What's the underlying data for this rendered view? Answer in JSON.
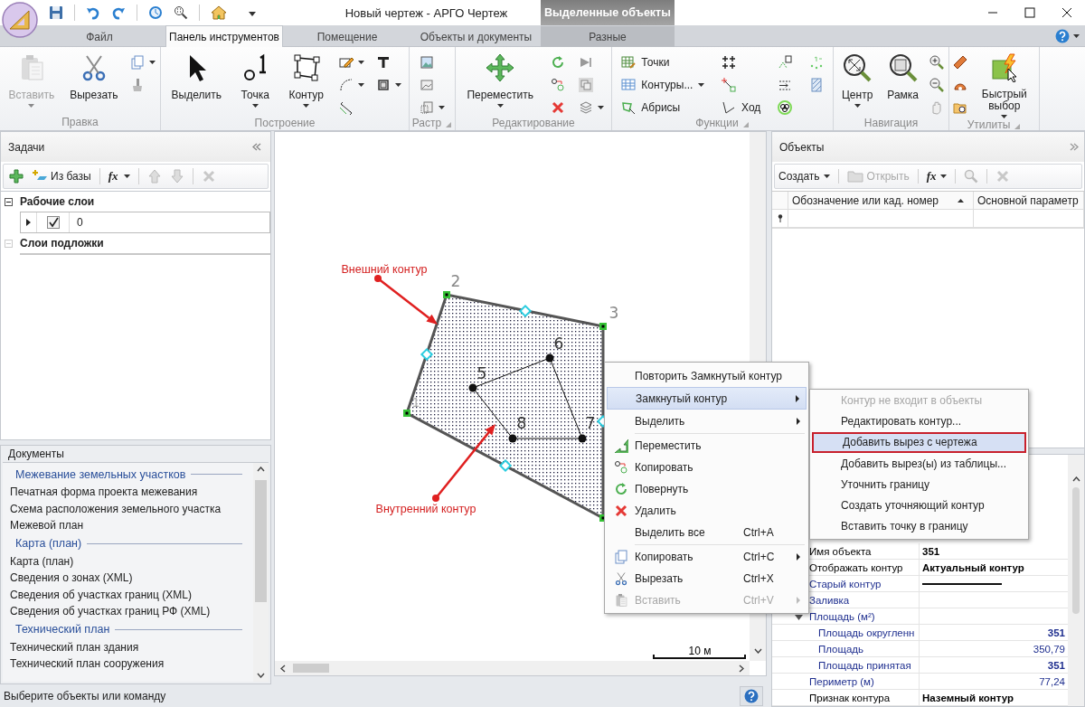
{
  "window": {
    "title": "Новый чертеж - АРГО Чертеж",
    "context_tab": "Выделенные объекты"
  },
  "tabs": [
    {
      "label": "Файл",
      "selected": false,
      "contextual": false
    },
    {
      "label": "Панель инструментов",
      "selected": true,
      "contextual": false
    },
    {
      "label": "Помещение",
      "selected": false,
      "contextual": false
    },
    {
      "label": "Объекты и документы",
      "selected": false,
      "contextual": false
    },
    {
      "label": "Разные",
      "selected": false,
      "contextual": true
    }
  ],
  "ribbon": {
    "groups": [
      {
        "label": "Правка",
        "buttons": [
          {
            "label": "Вставить",
            "disabled": true
          },
          {
            "label": "Вырезать",
            "disabled": false
          }
        ]
      },
      {
        "label": "Построение",
        "buttons": [
          {
            "label": "Выделить",
            "disabled": false
          },
          {
            "label": "Точка",
            "disabled": false
          },
          {
            "label": "Контур",
            "disabled": false
          }
        ]
      },
      {
        "label": "Растр"
      },
      {
        "label": "Редактирование",
        "buttons": [
          {
            "label": "Переместить",
            "disabled": false
          }
        ]
      },
      {
        "label": "Функции",
        "buttons": [
          {
            "label": "Точки",
            "disabled": false
          },
          {
            "label": "Контуры...",
            "disabled": false
          },
          {
            "label": "Абрисы",
            "disabled": false
          },
          {
            "label": "Ход",
            "disabled": false
          }
        ]
      },
      {
        "label": "Навигация",
        "buttons": [
          {
            "label": "Центр",
            "disabled": false
          },
          {
            "label": "Рамка",
            "disabled": false
          }
        ]
      },
      {
        "label": "Утилиты",
        "buttons": [
          {
            "label": "Быстрый выбор",
            "disabled": false
          }
        ]
      }
    ]
  },
  "tasks": {
    "title": "Задачи",
    "toolbar": {
      "from_db": "Из базы",
      "formula": "fx"
    },
    "sections": [
      {
        "title": "Рабочие слои",
        "expanded": true,
        "children": [
          {
            "name": "0",
            "checked": true,
            "expanded": false
          }
        ]
      },
      {
        "title": "Слои подложки",
        "expanded": true
      }
    ]
  },
  "documents": {
    "title": "Документы",
    "groups": [
      {
        "title": "Межевание земельных участков",
        "items": [
          "Печатная форма проекта межевания",
          "Схема расположения земельного участка",
          "Межевой план"
        ]
      },
      {
        "title": "Карта (план)",
        "items": [
          "Карта (план)",
          "Сведения о зонах (XML)",
          "Сведения об участках границ (XML)",
          "Сведения об участках границ РФ (XML)"
        ]
      },
      {
        "title": "Технический план",
        "items": [
          "Технический план здания",
          "Технический план сооружения"
        ]
      }
    ]
  },
  "drawing": {
    "outer_points": [
      {
        "label": "1"
      },
      {
        "label": "2"
      },
      {
        "label": "3"
      }
    ],
    "inner_points": [
      {
        "label": "5"
      },
      {
        "label": "6"
      },
      {
        "label": "7"
      },
      {
        "label": "8"
      }
    ],
    "annotations": [
      {
        "text": "Внешний контур"
      },
      {
        "text": "Внутренний контур"
      }
    ],
    "scale": "10 м"
  },
  "objects": {
    "title": "Объекты",
    "toolbar": [
      {
        "kind": "plain",
        "label": "Создать",
        "disabled": false,
        "dropdown": true
      },
      {
        "kind": "folder",
        "label": "Открыть",
        "disabled": true,
        "dropdown": false
      },
      {
        "kind": "formula",
        "label": "fx",
        "disabled": false,
        "dropdown": true
      }
    ],
    "columns": [
      {
        "label": "Обозначение или кад. номер",
        "sorted": true
      },
      {
        "label": "Основной параметр",
        "sorted": false
      }
    ]
  },
  "properties": {
    "rows": [
      {
        "name": "Имя объекта",
        "kind": "text",
        "value": "351",
        "bold": true,
        "color": "#000000"
      },
      {
        "name": "Отображать контур",
        "kind": "text",
        "value": "Актуальный контур",
        "bold": true,
        "color": "#000000"
      },
      {
        "name": "Старый контур",
        "kind": "line",
        "color": "#1f2f8f"
      },
      {
        "name": "Заливка",
        "kind": "text",
        "color": "#1f2f8f"
      },
      {
        "name": "Площадь (м²)",
        "kind": "group",
        "expanded": true,
        "color": "#1f2f8f",
        "children": [
          {
            "name": "Площадь округленн",
            "kind": "number",
            "value": "351",
            "bold": true,
            "color": "#1f2f8f"
          },
          {
            "name": "Площадь",
            "kind": "number",
            "value": "350,79",
            "bold": false,
            "color": "#1f2f8f"
          },
          {
            "name": "Площадь принятая",
            "kind": "number",
            "value": "351",
            "bold": true,
            "color": "#1f2f8f"
          }
        ]
      },
      {
        "name": "Периметр (м)",
        "kind": "number",
        "value": "77,24",
        "bold": false,
        "color": "#1f2f8f"
      },
      {
        "name": "Признак контура",
        "kind": "text",
        "value": "Наземный контур",
        "bold": true,
        "color": "#000000"
      }
    ]
  },
  "context_menu": {
    "sections": [
      {
        "items": [
          {
            "label": "Повторить Замкнутый контур",
            "selected": false,
            "disabled": false,
            "submenu": false
          },
          {
            "label": "Замкнутый контур",
            "selected": true,
            "disabled": false,
            "submenu": true
          },
          {
            "label": "Выделить",
            "selected": false,
            "disabled": false,
            "submenu": true
          }
        ]
      },
      {
        "items": [
          {
            "label": "Переместить",
            "selected": false,
            "disabled": false,
            "submenu": false
          },
          {
            "label": "Копировать",
            "selected": false,
            "disabled": false,
            "submenu": false
          },
          {
            "label": "Повернуть",
            "selected": false,
            "disabled": false,
            "submenu": false
          },
          {
            "label": "Удалить",
            "selected": false,
            "disabled": false,
            "submenu": false
          },
          {
            "label": "Выделить все",
            "shortcut": "Ctrl+A",
            "selected": false,
            "disabled": false,
            "submenu": false
          }
        ]
      },
      {
        "items": [
          {
            "label": "Копировать",
            "shortcut": "Ctrl+C",
            "selected": false,
            "disabled": false,
            "submenu": true
          },
          {
            "label": "Вырезать",
            "shortcut": "Ctrl+X",
            "selected": false,
            "disabled": false,
            "submenu": false
          },
          {
            "label": "Вставить",
            "shortcut": "Ctrl+V",
            "selected": false,
            "disabled": true,
            "submenu": true
          }
        ]
      }
    ]
  },
  "submenu": {
    "items": [
      {
        "label": "Контур не входит в объекты",
        "selected": false,
        "disabled": true
      },
      {
        "label": "Редактировать контур...",
        "selected": false,
        "disabled": false
      },
      {
        "label": "Добавить вырез с чертежа",
        "selected": true,
        "disabled": false
      },
      {
        "label": "Добавить вырез(ы) из таблицы...",
        "selected": false,
        "disabled": false
      },
      {
        "label": "Уточнить границу",
        "selected": false,
        "disabled": false
      },
      {
        "label": "Создать уточняющий контур",
        "selected": false,
        "disabled": false
      },
      {
        "label": "Вставить точку в границу",
        "selected": false,
        "disabled": false
      }
    ]
  },
  "status_bar": {
    "text": "Выберите объекты или команду"
  }
}
